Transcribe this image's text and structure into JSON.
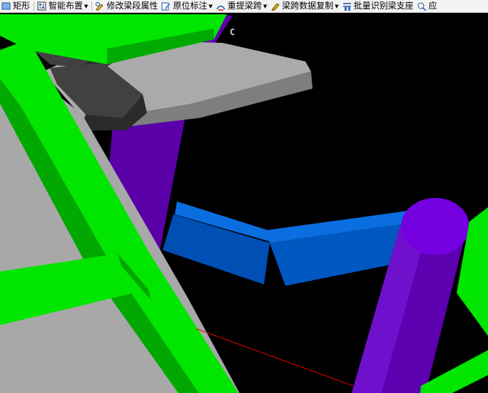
{
  "toolbar": {
    "items": [
      {
        "label": "矩形",
        "icon": "rectangle-icon",
        "dropdown": false
      },
      {
        "label": "智能布置",
        "icon": "smart-layout-icon",
        "dropdown": true
      },
      {
        "label": "修改梁段属性",
        "icon": "edit-beam-segment-icon",
        "dropdown": false
      },
      {
        "label": "原位标注",
        "icon": "in-place-annotation-icon",
        "dropdown": true
      },
      {
        "label": "重提梁跨",
        "icon": "re-extract-span-icon",
        "dropdown": true
      },
      {
        "label": "梁跨数据复制",
        "icon": "copy-span-data-icon",
        "dropdown": true
      },
      {
        "label": "批量识别梁支座",
        "icon": "batch-identify-support-icon",
        "dropdown": false
      },
      {
        "label": "应",
        "icon": "apply-icon",
        "dropdown": false
      }
    ]
  },
  "viewport": {
    "axis_label": "C",
    "colors": {
      "background": "#000000",
      "wall_green": "#00e600",
      "slab_gray": "#a9a9a9",
      "column_purple": "#6000c8",
      "beam_blue": "#0055bb",
      "selection_line": "#e00000"
    }
  }
}
